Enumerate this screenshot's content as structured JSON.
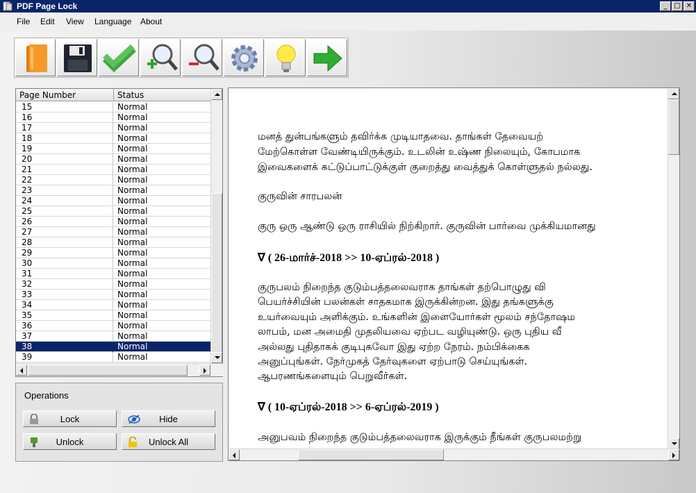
{
  "window": {
    "title": "PDF Page Lock",
    "controls": {
      "minimize": "_",
      "maximize": "□",
      "close": "✕"
    }
  },
  "menu": [
    "File",
    "Edit",
    "View",
    "Language",
    "About"
  ],
  "toolbar": {
    "buttons": [
      "open-folder-icon",
      "save-icon",
      "check-icon",
      "zoom-in-icon",
      "zoom-out-icon",
      "settings-gear-icon",
      "lightbulb-icon",
      "next-arrow-icon"
    ]
  },
  "list": {
    "headers": {
      "page": "Page Number",
      "status": "Status"
    },
    "rows": [
      {
        "page": "15",
        "status": "Normal"
      },
      {
        "page": "16",
        "status": "Normal"
      },
      {
        "page": "17",
        "status": "Normal"
      },
      {
        "page": "18",
        "status": "Normal"
      },
      {
        "page": "19",
        "status": "Normal"
      },
      {
        "page": "20",
        "status": "Normal"
      },
      {
        "page": "21",
        "status": "Normal"
      },
      {
        "page": "22",
        "status": "Normal"
      },
      {
        "page": "23",
        "status": "Normal"
      },
      {
        "page": "24",
        "status": "Normal"
      },
      {
        "page": "25",
        "status": "Normal"
      },
      {
        "page": "26",
        "status": "Normal"
      },
      {
        "page": "27",
        "status": "Normal"
      },
      {
        "page": "28",
        "status": "Normal"
      },
      {
        "page": "29",
        "status": "Normal"
      },
      {
        "page": "30",
        "status": "Normal"
      },
      {
        "page": "31",
        "status": "Normal"
      },
      {
        "page": "32",
        "status": "Normal"
      },
      {
        "page": "33",
        "status": "Normal"
      },
      {
        "page": "34",
        "status": "Normal"
      },
      {
        "page": "35",
        "status": "Normal"
      },
      {
        "page": "36",
        "status": "Normal"
      },
      {
        "page": "37",
        "status": "Normal"
      },
      {
        "page": "38",
        "status": "Normal"
      },
      {
        "page": "39",
        "status": "Normal"
      }
    ],
    "selected_page": "38"
  },
  "operations": {
    "title": "Operations",
    "lock": "Lock",
    "hide": "Hide",
    "unlock": "Unlock",
    "unlock_all": "Unlock All"
  },
  "document": {
    "para1": [
      "மனத் துன்பங்களும் தவிர்க்க முடியாதவை. தாங்கள் தேவையற்",
      "மேற்கொள்ள வேண்டியிருக்கும். உடலின் உஷ்ண நிலையும், கோபமாக",
      "இவைகளைக் கட்டுப்பாட்டுக்குள் குறைத்து வைத்துக் கொள்ளுதல் நல்லது."
    ],
    "subhead": "குருவின் சாரபலன்",
    "para2": "குரு ஒரு ஆண்டு ஒரு ராசியில் நிற்கிறார். குருவின் பார்வை முக்கியமானது",
    "period1": "∇ ( 26-மார்ச்-2018  >>  10-ஏப்ரல்-2018 )",
    "para3": [
      "குருபலம் நிறைந்த குடும்பத்தலைவராக தாங்கள் தற்பொழுது வி",
      "பெயர்ச்சியின் பலன்கள் சாதகமாக இருக்கின்றன. இது தங்களுக்கு",
      "உயர்வையும் அளிக்கும். உங்களின் இளையோர்கள் மூலம் சந்தோஷம",
      "லாபம், மன அமைதி முதலியவை ஏற்பட வழியுண்டு. ஒரு புதிய வீ",
      "அல்லது புதிதாகக் குடிபுகவோ இது ஏற்ற நேரம். நம்பிக்கைக",
      "அனுப்புங்கள். நேர்முகத் தேர்வுகளை ஏற்பாடு செய்யுங்கள்.",
      "ஆபரணங்களையும் பெறுவீர்கள்."
    ],
    "period2": "∇ ( 10-ஏப்ரல்-2018  >>  6-ஏப்ரல்-2019 )",
    "para4": "அனுபவம் நிறைந்த குடும்பத்தலைவராக இருக்கும் நீங்கள் குருபலமற்று"
  }
}
